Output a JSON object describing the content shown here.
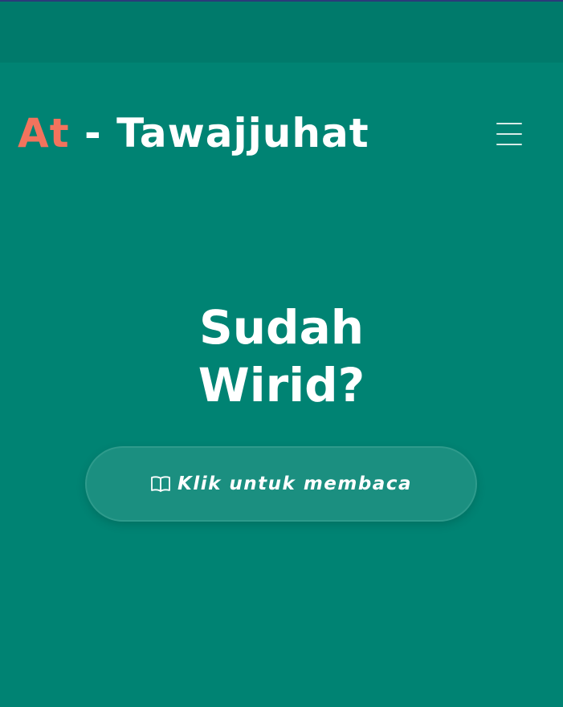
{
  "header": {
    "brand_accent": "At",
    "brand_rest": " - Tawajjuhat",
    "menu_icon": "hamburger-menu-icon"
  },
  "hero": {
    "title_line1": "Sudah",
    "title_line2": "Wirid?"
  },
  "cta": {
    "icon": "open-book-icon",
    "label": "Klik untuk membaca"
  },
  "colors": {
    "background": "#008373",
    "status_bar": "#007a6b",
    "brand_accent": "#f2735d",
    "text": "#ffffff",
    "button_fill": "#1b8f80",
    "button_border": "#2e9b8c"
  }
}
